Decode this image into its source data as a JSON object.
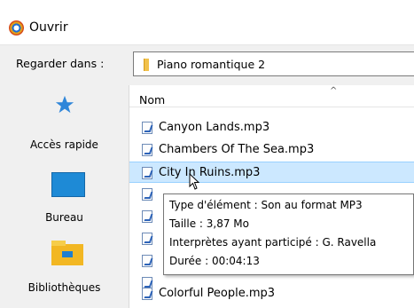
{
  "dialog": {
    "title": "Ouvrir",
    "title_icon": "app-icon"
  },
  "lookin": {
    "label": "Regarder dans :",
    "value": "Piano romantique 2",
    "icon": "folder-icon"
  },
  "places": [
    {
      "label": "Accès rapide",
      "icon": "star-icon"
    },
    {
      "label": "Bureau",
      "icon": "desktop-icon"
    },
    {
      "label": "Bibliothèques",
      "icon": "library-icon"
    }
  ],
  "filelist": {
    "column_header": "Nom",
    "sort_indicator": "^",
    "files": [
      {
        "name": "Canyon Lands.mp3",
        "selected": false
      },
      {
        "name": "Chambers Of The Sea.mp3",
        "selected": false
      },
      {
        "name": "City In Ruins.mp3",
        "selected": true
      },
      {
        "name": "",
        "selected": false
      },
      {
        "name": "",
        "selected": false
      },
      {
        "name": "",
        "selected": false
      },
      {
        "name": "",
        "selected": false
      },
      {
        "name": "",
        "selected": false
      },
      {
        "name": "Colorful People.mp3",
        "selected": false
      }
    ]
  },
  "tooltip": {
    "line1": "Type d'élément : Son au format MP3",
    "line2": "Taille : 3,87 Mo",
    "line3": "Interprètes ayant participé : G. Ravella",
    "line4": "Durée : 00:04:13"
  },
  "colors": {
    "selection": "#cce8ff",
    "selection_border": "#99d1ff",
    "accent": "#1e8ad6"
  }
}
